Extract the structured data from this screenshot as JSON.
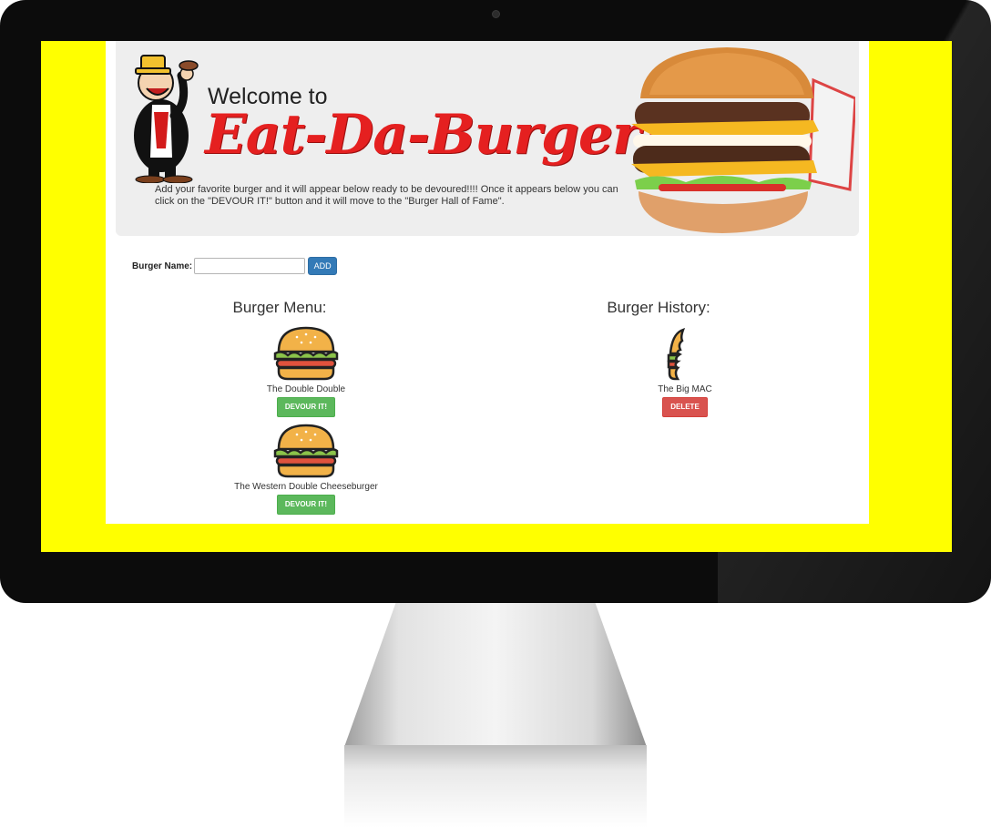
{
  "header": {
    "welcome": "Welcome to",
    "brand": "Eat-Da-Burger!",
    "intro": "Add your favorite burger and it will appear below ready to be devoured!!!! Once it appears below you can click on the \"DEVOUR IT!\" button and it will move to the \"Burger Hall of Fame\"."
  },
  "form": {
    "label": "Burger Name:",
    "value": "",
    "placeholder": "",
    "add_label": "ADD"
  },
  "menu": {
    "title": "Burger Menu:",
    "items": [
      {
        "name": "The Double Double",
        "button": "DEVOUR IT!"
      },
      {
        "name": "The Western Double Cheeseburger",
        "button": "DEVOUR IT!"
      }
    ]
  },
  "history": {
    "title": "Burger History:",
    "items": [
      {
        "name": "The Big MAC",
        "button": "DELETE"
      }
    ]
  },
  "colors": {
    "screen_background": "#ffff00",
    "brand_red": "#e52020",
    "add_button": "#337ab7",
    "devour_button": "#5cb85c",
    "delete_button": "#d9534f"
  },
  "icons": [
    "mascot-illustration",
    "burger-photo",
    "burger-icon",
    "bitten-burger-icon"
  ]
}
